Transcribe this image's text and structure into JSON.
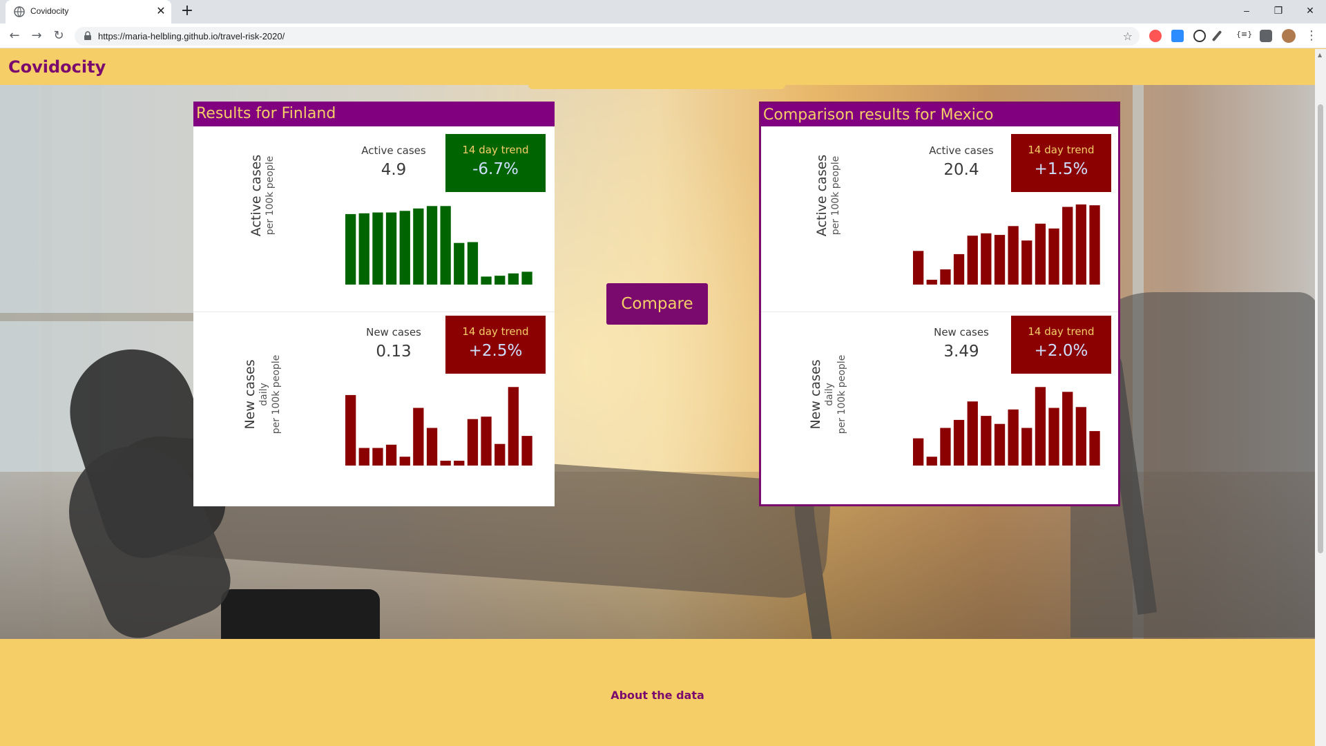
{
  "browser": {
    "tab_title": "Covidocity",
    "new_tab": "+",
    "tab_close": "✕",
    "url": "https://maria-helbling.github.io/travel-risk-2020/",
    "window_controls": [
      "–",
      "❐",
      "✕"
    ],
    "nav": {
      "back": "←",
      "forward": "→",
      "reload": "↻"
    },
    "star": "☆",
    "menu": "⋮"
  },
  "navbar": {
    "brand": "Covidocity"
  },
  "left_card": {
    "title": "Results for Finland",
    "active": {
      "axis_title": "Active cases",
      "axis_sub": "per 100k people",
      "label": "Active cases",
      "value": "4.9",
      "trend_label": "14 day trend",
      "trend_value": "-6.7%",
      "trend_color": "#006400",
      "bar_color": "#006400",
      "bars": [
        0.88,
        0.89,
        0.9,
        0.9,
        0.92,
        0.95,
        0.98,
        0.98,
        0.52,
        0.53,
        0.1,
        0.11,
        0.14,
        0.16
      ]
    },
    "new": {
      "axis_title": "New cases",
      "axis_sub1": "daily",
      "axis_sub2": "per 100k people",
      "label": "New cases",
      "value": "0.13",
      "trend_label": "14 day trend",
      "trend_value": "+2.5%",
      "trend_color": "#8b0000",
      "bar_color": "#8b0000",
      "bars": [
        0.88,
        0.22,
        0.22,
        0.26,
        0.11,
        0.72,
        0.47,
        0.06,
        0.06,
        0.58,
        0.61,
        0.27,
        0.98,
        0.37
      ]
    }
  },
  "right_card": {
    "title": "Comparison results for Mexico",
    "active": {
      "axis_title": "Active cases",
      "axis_sub": "per 100k people",
      "label": "Active cases",
      "value": "20.4",
      "trend_label": "14 day trend",
      "trend_value": "+1.5%",
      "trend_color": "#8b0000",
      "bar_color": "#8b0000",
      "bars": [
        0.42,
        0.06,
        0.19,
        0.38,
        0.61,
        0.64,
        0.62,
        0.73,
        0.55,
        0.76,
        0.7,
        0.97,
        1.0,
        0.99
      ]
    },
    "new": {
      "axis_title": "New cases",
      "axis_sub1": "daily",
      "axis_sub2": "per 100k people",
      "label": "New cases",
      "value": "3.49",
      "trend_label": "14 day trend",
      "trend_value": "+2.0%",
      "trend_color": "#8b0000",
      "bar_color": "#8b0000",
      "bars": [
        0.34,
        0.11,
        0.47,
        0.57,
        0.8,
        0.62,
        0.52,
        0.7,
        0.47,
        0.98,
        0.72,
        0.92,
        0.73,
        0.43
      ]
    }
  },
  "compare_button": "Compare",
  "footer": {
    "about": "About the data"
  }
}
